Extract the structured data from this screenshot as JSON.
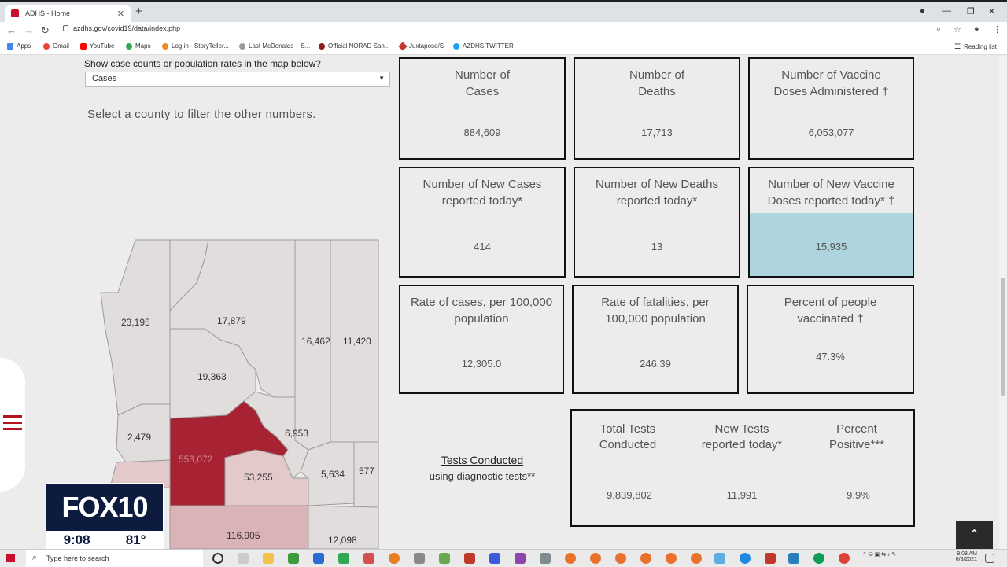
{
  "browser": {
    "tab_title": "ADHS - Home",
    "url": "azdhs.gov/covid19/data/index.php",
    "bookmarks": [
      "Apps",
      "Gmail",
      "YouTube",
      "Maps",
      "Log in - StoryTeller...",
      "Last McDonalds – S...",
      "Official NORAD San...",
      "Juxtapose/S",
      "AZDHS TWITTER"
    ],
    "reading_list": "Reading list"
  },
  "filter": {
    "question": "Show case counts or population rates in the map below?",
    "selected": "Cases",
    "instruction": "Select a county to filter the other numbers."
  },
  "cards": [
    {
      "label": "Number of\nCases",
      "value": "884,609"
    },
    {
      "label": "Number of\nDeaths",
      "value": "17,713"
    },
    {
      "label": "Number of Vaccine\nDoses Administered †",
      "value": "6,053,077"
    },
    {
      "label": "Number of New Cases\nreported today*",
      "value": "414"
    },
    {
      "label": "Number of New Deaths\nreported today*",
      "value": "13"
    },
    {
      "label": "Number of New Vaccine\nDoses reported today* †",
      "value": "15,935"
    },
    {
      "label": "Rate of cases, per 100,000\npopulation",
      "value": "12,305.0"
    },
    {
      "label": "Rate of fatalities, per\n100,000 population",
      "value": "246.39"
    },
    {
      "label": "Percent of people\nvaccinated †",
      "value": "47.3%"
    }
  ],
  "tests": {
    "title": "Tests Conducted",
    "subtitle": "using diagnostic tests**",
    "columns": [
      {
        "label": "Total Tests\nConducted",
        "value": "9,839,802"
      },
      {
        "label": "New Tests\nreported today*",
        "value": "11,991"
      },
      {
        "label": "Percent\nPositive***",
        "value": "9.9%"
      }
    ]
  },
  "map": {
    "counties": [
      "23,195",
      "17,879",
      "16,462",
      "11,420",
      "19,363",
      "2,479",
      "553,072",
      "6,953",
      "53,255",
      "5,634",
      "577",
      "116,905",
      "12,098"
    ],
    "colors": {
      "light": "#e2dddd",
      "mid": "#e3c9c9",
      "pink": "#d9b3b5",
      "dark": "#a72334"
    }
  },
  "fox": {
    "brand": "FOX10",
    "time": "9:08",
    "temp": "81°"
  },
  "taskbar": {
    "search_placeholder": "Type here to search",
    "clock_time": "9:08 AM",
    "clock_date": "6/8/2021"
  }
}
